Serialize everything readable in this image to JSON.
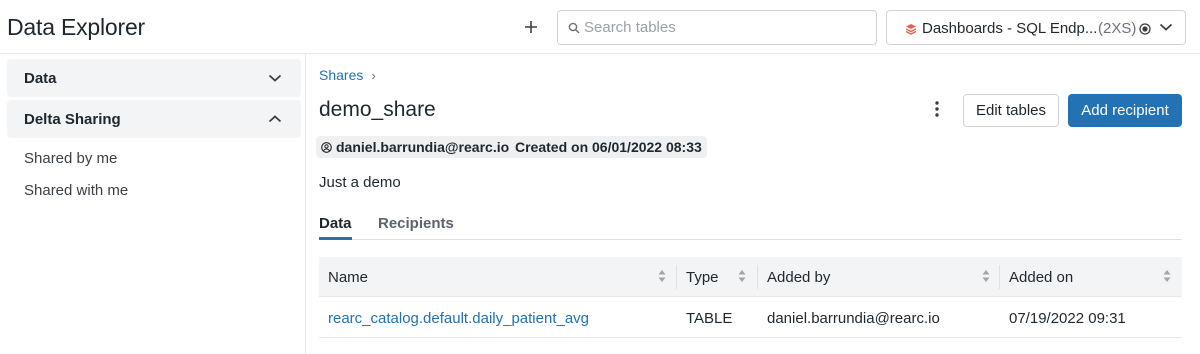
{
  "app": {
    "title": "Data Explorer"
  },
  "header": {
    "search_placeholder": "Search tables",
    "endpoint": {
      "name": "Dashboards - SQL Endp...",
      "size": "(2XS)",
      "icon": "warehouse-icon",
      "status_icon": "status-running-icon"
    },
    "icons": {
      "add": "plus-icon"
    }
  },
  "sidebar": {
    "sections": [
      {
        "label": "Data",
        "expanded": false
      },
      {
        "label": "Delta Sharing",
        "expanded": true
      }
    ],
    "items": [
      {
        "label": "Shared by me"
      },
      {
        "label": "Shared with me"
      }
    ]
  },
  "main": {
    "breadcrumb": {
      "label": "Shares",
      "separator": "›"
    },
    "title": "demo_share",
    "actions": {
      "edit_label": "Edit tables",
      "add_label": "Add recipient"
    },
    "owner": "daniel.barrundia@rearc.io",
    "created": "Created on 06/01/2022 08:33",
    "description": "Just a demo",
    "tabs": [
      {
        "label": "Data",
        "active": true
      },
      {
        "label": "Recipients",
        "active": false
      }
    ],
    "table": {
      "columns": [
        "Name",
        "Type",
        "Added by",
        "Added on"
      ],
      "rows": [
        {
          "name": "rearc_catalog.default.daily_patient_avg",
          "type": "TABLE",
          "added_by": "daniel.barrundia@rearc.io",
          "added_on": "07/19/2022 09:31"
        }
      ]
    }
  },
  "colors": {
    "accent": "#2272b4",
    "warehouse_icon": "#e8604c",
    "section_bg": "#f2f4f6"
  }
}
